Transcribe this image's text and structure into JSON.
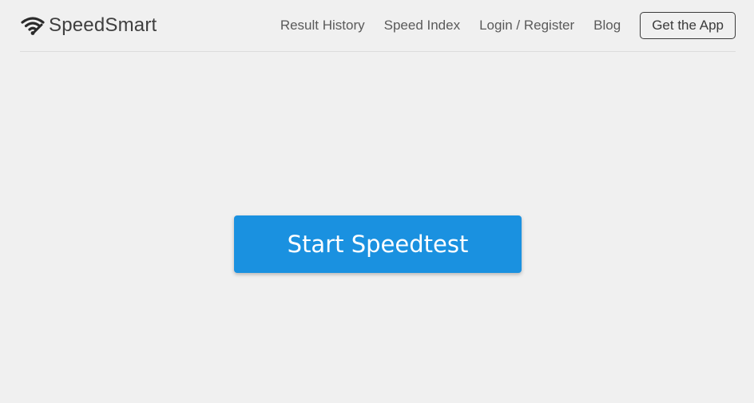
{
  "brand": {
    "name": "SpeedSmart",
    "icon": "wifi-icon"
  },
  "nav": {
    "result_history": "Result History",
    "speed_index": "Speed Index",
    "login_register": "Login / Register",
    "blog": "Blog",
    "get_app": "Get the App"
  },
  "main": {
    "start_label": "Start Speedtest"
  },
  "colors": {
    "accent": "#1a91e0",
    "background": "#f0f0f0",
    "text": "#5a5a5a"
  }
}
